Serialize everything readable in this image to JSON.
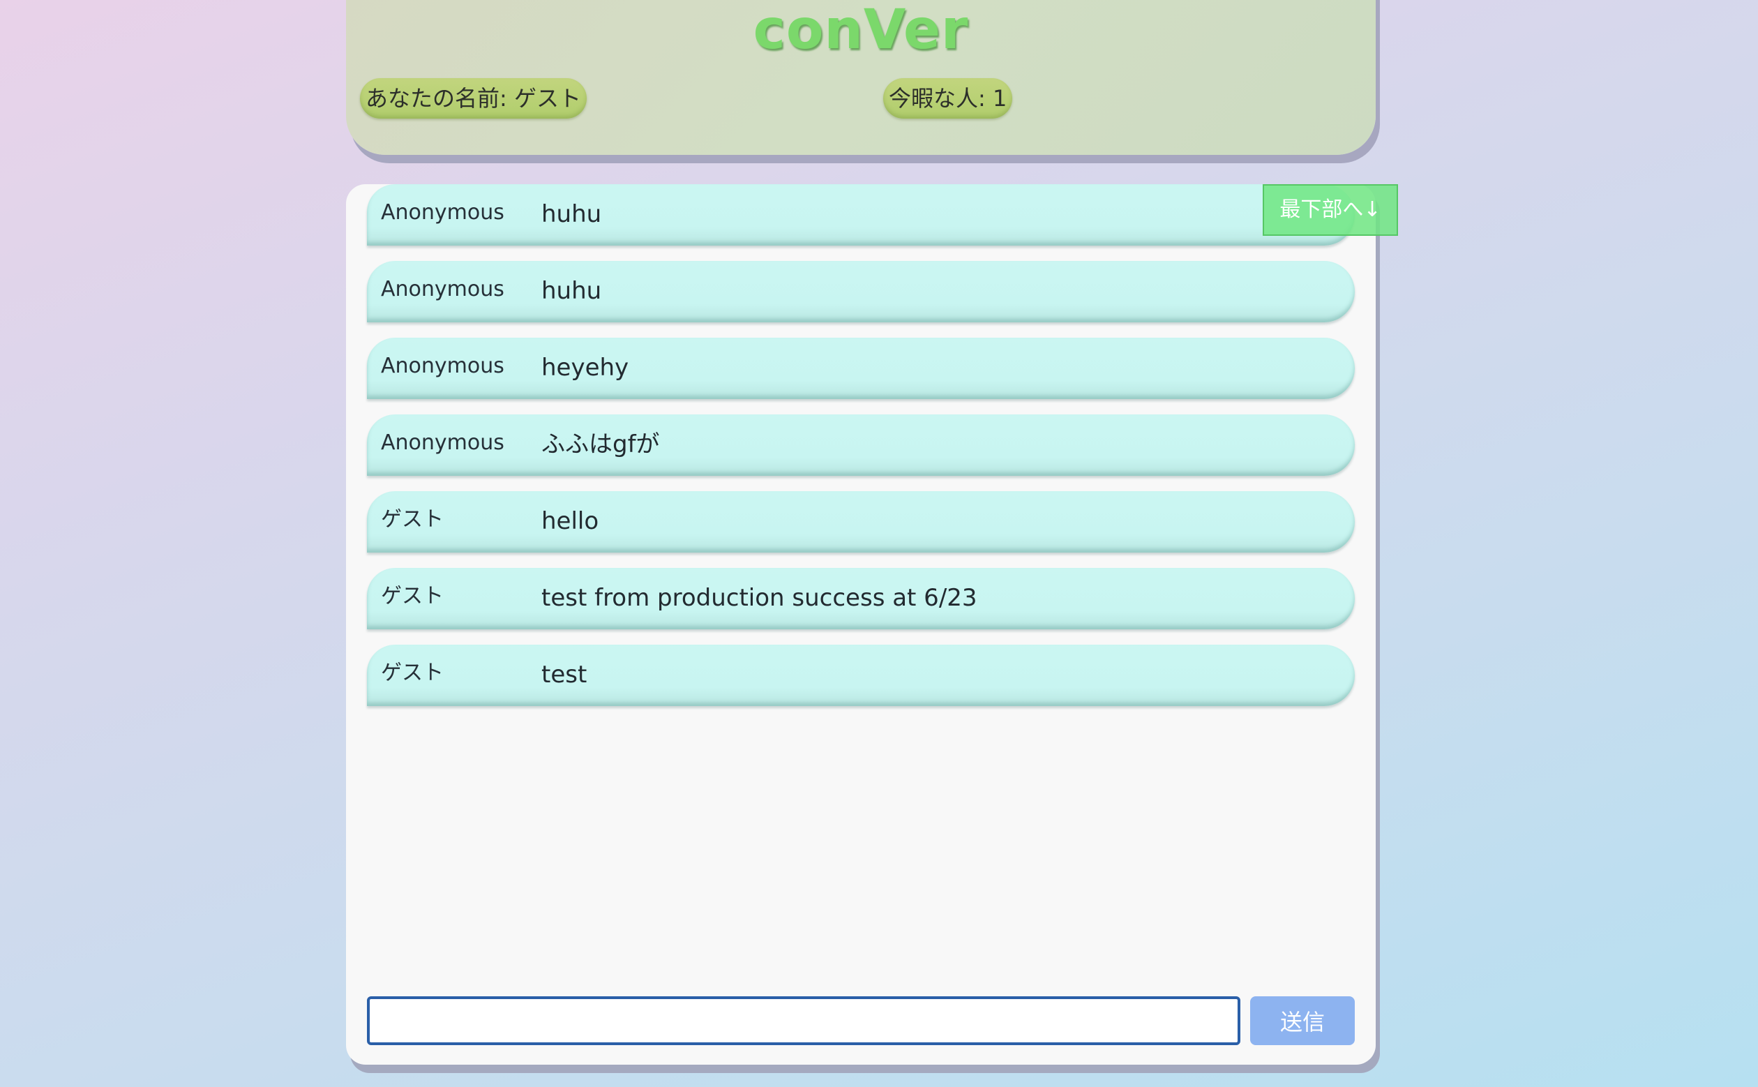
{
  "header": {
    "title": "conVer",
    "name_label": "あなたの名前: ゲスト",
    "idle_label": "今暇な人: 1"
  },
  "scroll_button": {
    "label": "最下部へ↓"
  },
  "messages": [
    {
      "name": "Anonymous",
      "text": "huhu"
    },
    {
      "name": "Anonymous",
      "text": "huhu"
    },
    {
      "name": "Anonymous",
      "text": "heyehy"
    },
    {
      "name": "Anonymous",
      "text": "ふふはgfが"
    },
    {
      "name": "ゲスト",
      "text": "hello"
    },
    {
      "name": "ゲスト",
      "text": "test from production success at 6/23"
    },
    {
      "name": "ゲスト",
      "text": "test"
    }
  ],
  "composer": {
    "input_value": "",
    "send_label": "送信"
  },
  "colors": {
    "title": "#7bd86b",
    "message_bubble": "#cbf6f2",
    "send_button": "#8db3f0",
    "scroll_button": "#70e682",
    "input_border": "#2a5fa8"
  }
}
